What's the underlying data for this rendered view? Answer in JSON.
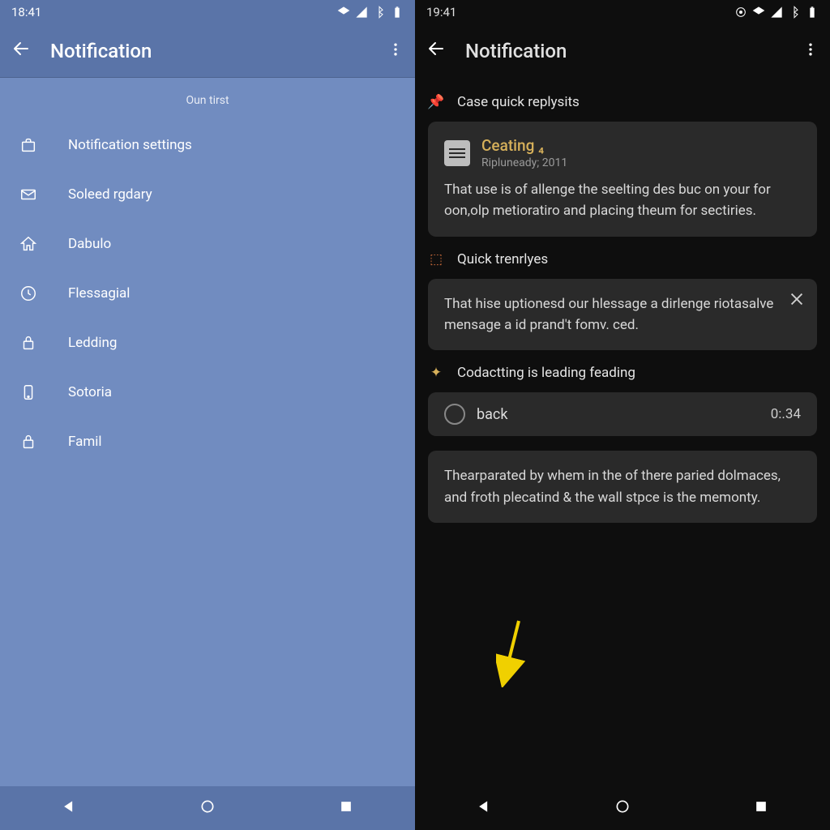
{
  "left": {
    "status": {
      "time": "18:41"
    },
    "appbar": {
      "title": "Notification"
    },
    "subtitle": "Oun tirst",
    "menu": [
      {
        "icon": "briefcase",
        "label": "Notification settings"
      },
      {
        "icon": "mail",
        "label": "Soleed rgdary"
      },
      {
        "icon": "home",
        "label": "Dabulo"
      },
      {
        "icon": "clock",
        "label": "Flessagial"
      },
      {
        "icon": "lock",
        "label": "Ledding"
      },
      {
        "icon": "phone",
        "label": "Sotoria"
      },
      {
        "icon": "lock2",
        "label": "Famil"
      }
    ]
  },
  "right": {
    "status": {
      "time": "19:41"
    },
    "appbar": {
      "title": "Notification"
    },
    "sections": [
      {
        "icon": "pin",
        "title": "Case quick replysits",
        "card": {
          "type": "rich",
          "heading": "Ceating  ₄",
          "sub": "Ripluneady; 2011",
          "body": "That use is of allenge the seelting des buc on your for oon,olp metioratiro and placing theum for sectiries."
        }
      },
      {
        "icon": "pin2",
        "title": "Quick trenrlyes",
        "card": {
          "type": "closable",
          "body": "That hise uptionesd our hlessage a dirlenge riotasalve mensage a id prand't fomv. ced."
        }
      },
      {
        "icon": "star",
        "title": "Codactting is leading feading",
        "card": {
          "type": "audio",
          "label": "back",
          "time": "0:.34"
        }
      },
      {
        "card": {
          "type": "plain",
          "body": "Thearparated by whem in the of there paried dolmaces, and froth plecatind & the wall stpce is the memonty."
        }
      }
    ]
  }
}
